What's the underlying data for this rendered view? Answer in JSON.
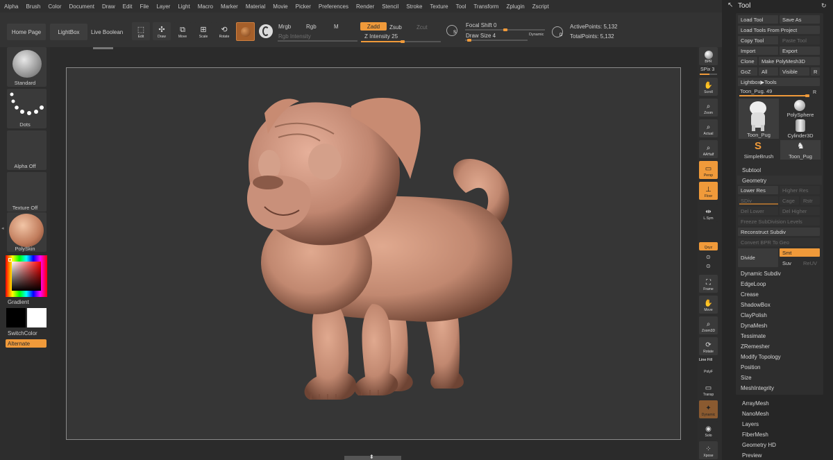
{
  "menu": [
    "Alpha",
    "Brush",
    "Color",
    "Document",
    "Draw",
    "Edit",
    "File",
    "Layer",
    "Light",
    "Macro",
    "Marker",
    "Material",
    "Movie",
    "Picker",
    "Preferences",
    "Render",
    "Stencil",
    "Stroke",
    "Texture",
    "Tool",
    "Transform",
    "Zplugin",
    "Zscript"
  ],
  "shelf": {
    "home_page": "Home Page",
    "lightbox": "LightBox",
    "live_boolean": "Live Boolean",
    "edit": "Edit",
    "draw": "Draw",
    "move": "Move",
    "scale": "Scale",
    "rotate": "Rotate",
    "mrgb": "Mrgb",
    "rgb": "Rgb",
    "m": "M",
    "rgb_intensity": "Rgb Intensity",
    "zadd": "Zadd",
    "zsub": "Zsub",
    "zcut": "Zcut",
    "z_intensity": "Z Intensity 25",
    "z_intensity_value": 25,
    "focal_shift": "Focal Shift 0",
    "draw_size": "Draw Size 4",
    "dynamic": "Dynamic",
    "active_points": "ActivePoints: 5,132",
    "total_points": "TotalPoints: 5,132",
    "s_label": "S",
    "d_label": "D"
  },
  "left": {
    "standard": "Standard",
    "dots": "Dots",
    "alpha_off": "Alpha Off",
    "texture_off": "Texture Off",
    "polyskin": "PolySkin",
    "gradient": "Gradient",
    "switchcolor": "SwitchColor",
    "alternate": "Alternate"
  },
  "rstrip": {
    "bpr": "BPR",
    "spix": "SPix 3",
    "scroll": "Scroll",
    "zoom": "Zoom",
    "actual": "Actual",
    "aahalf": "AAHalf",
    "persp": "Persp",
    "floor": "Floor",
    "lsym": "L.Sym",
    "xyz": "Qxyz",
    "frame": "Frame",
    "move": "Move",
    "zoom3d": "Zoom3D",
    "rotate": "Rotate",
    "line_fill": "Line Fill",
    "polyf": "PolyF",
    "transp": "Transp",
    "dynamic": "Dynamic",
    "solo": "Solo",
    "xpose": "Xpose"
  },
  "palette": {
    "title": "Tool",
    "load_tool": "Load Tool",
    "save_as": "Save As",
    "load_from_project": "Load Tools From Project",
    "copy_tool": "Copy Tool",
    "paste_tool": "Paste Tool",
    "import": "Import",
    "export": "Export",
    "clone": "Clone",
    "make_polymesh": "Make PolyMesh3D",
    "goz": "GoZ",
    "all": "All",
    "visible": "Visible",
    "r": "R",
    "lightbox_tools": "Lightbox▶Tools",
    "tool_slider": "Toon_Pug. 49",
    "tool_slider_value": 49,
    "thumb_toon_pug": "Toon_Pug",
    "thumb_polysphere": "PolySphere",
    "thumb_cylinder": "Cylinder3D",
    "thumb_simplebrush": "SimpleBrush",
    "thumb_toon_pug2": "Toon_Pug",
    "subtool": "Subtool",
    "geometry": "Geometry",
    "lower_res": "Lower Res",
    "higher_res": "Higher Res",
    "sdiv": "SDiv",
    "cage": "Cage",
    "rstr": "Rstr",
    "del_lower": "Del Lower",
    "del_higher": "Del Higher",
    "freeze_subdiv": "Freeze SubDivision Levels",
    "reconstruct_subdiv": "Reconstruct Subdiv",
    "convert_bpr": "Convert BPR To Geo",
    "divide": "Divide",
    "smt": "Smt",
    "suv": "Suv",
    "reuv": "ReUV",
    "sections": [
      "Dynamic Subdiv",
      "EdgeLoop",
      "Crease",
      "ShadowBox",
      "ClayPolish",
      "DynaMesh",
      "Tessimate",
      "ZRemesher",
      "Modify Topology",
      "Position",
      "Size",
      "MeshIntegrity"
    ],
    "more": [
      "ArrayMesh",
      "NanoMesh",
      "Layers",
      "FiberMesh",
      "Geometry HD",
      "Preview"
    ]
  },
  "colors": {
    "accent": "#f09a3a",
    "model": "#c8907a"
  }
}
